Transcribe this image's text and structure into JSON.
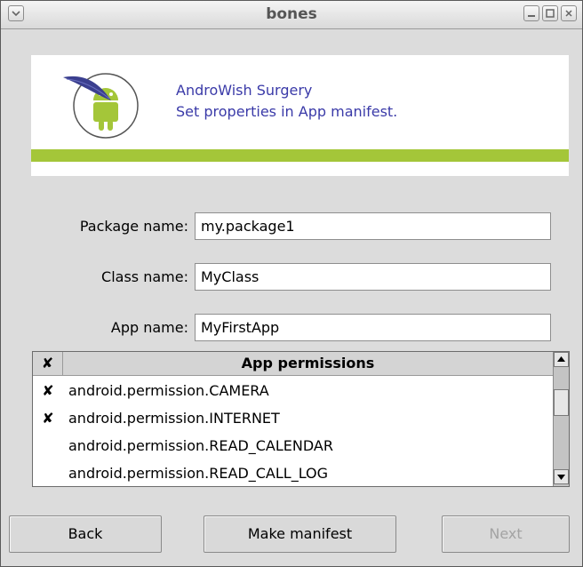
{
  "window": {
    "title": "bones"
  },
  "banner": {
    "line1": "AndroWish Surgery",
    "line2": "Set properties in App manifest."
  },
  "form": {
    "package_label": "Package name:",
    "package_value": "my.package1",
    "class_label": "Class name:",
    "class_value": "MyClass",
    "app_label": "App name:",
    "app_value": "MyFirstApp"
  },
  "permissions": {
    "check_header": "✘",
    "title_header": "App permissions",
    "rows": [
      {
        "checked": "✘",
        "name": "android.permission.CAMERA"
      },
      {
        "checked": "✘",
        "name": "android.permission.INTERNET"
      },
      {
        "checked": "",
        "name": "android.permission.READ_CALENDAR"
      },
      {
        "checked": "",
        "name": "android.permission.READ_CALL_LOG"
      }
    ]
  },
  "buttons": {
    "back": "Back",
    "make": "Make manifest",
    "next": "Next"
  },
  "colors": {
    "accent_green": "#a4c639",
    "banner_text": "#3a3aa8"
  }
}
